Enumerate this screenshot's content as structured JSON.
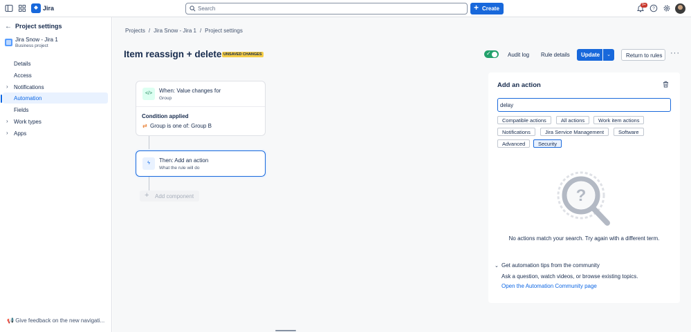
{
  "topbar": {
    "app_name": "Jira",
    "search_placeholder": "Search",
    "create_label": "Create",
    "notification_badge": "9+"
  },
  "sidebar": {
    "back_title": "Project settings",
    "project_name": "Jira Snow - Jira 1",
    "project_type": "Business project",
    "items": [
      {
        "label": "Details"
      },
      {
        "label": "Access"
      },
      {
        "label": "Notifications"
      },
      {
        "label": "Automation"
      },
      {
        "label": "Fields"
      },
      {
        "label": "Work types"
      },
      {
        "label": "Apps"
      }
    ],
    "feedback_label": "Give feedback on the new navigati..."
  },
  "breadcrumbs": [
    "Projects",
    "/",
    "Jira Snow - Jira 1",
    "/",
    "Project settings"
  ],
  "header": {
    "title": "Item reassign + delete",
    "unsaved_badge": "UNSAVED CHANGES",
    "audit_log": "Audit log",
    "rule_details": "Rule details",
    "update": "Update",
    "return_to_rules": "Return to rules",
    "rule_enabled": true
  },
  "rule": {
    "trigger": {
      "title": "When: Value changes for",
      "subtitle": "Group"
    },
    "condition": {
      "title": "Condition applied",
      "text": "Group is one of: Group B"
    },
    "action": {
      "title": "Then: Add an action",
      "subtitle": "What the rule will do"
    },
    "add_component": "Add component"
  },
  "panel": {
    "title": "Add an action",
    "search_value": "delay",
    "chips": [
      "Compatible actions",
      "All actions",
      "Work item actions",
      "Notifications",
      "Jira Service Management",
      "Software",
      "Advanced",
      "Security"
    ],
    "selected_chip": "Security",
    "empty_message": "No actions match your search. Try again with a different term.",
    "tips_title": "Get automation tips from the community",
    "tips_body": "Ask a question, watch videos, or browse existing topics.",
    "tips_link": "Open the Automation Community page"
  },
  "colors": {
    "brand": "#1868db",
    "toggle_on": "#22a06b",
    "unsaved": "#f5cd47"
  }
}
